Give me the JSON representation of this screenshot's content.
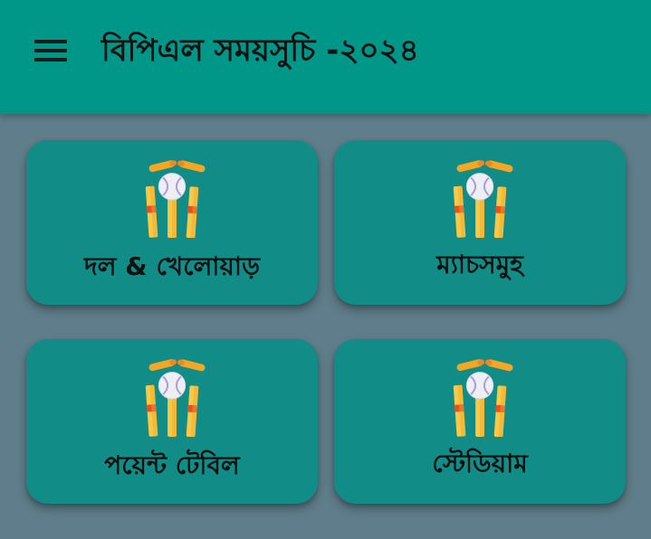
{
  "app": {
    "title": "বিপিএল সময়সুচি -২০২৪",
    "menu_icon": "hamburger-menu-icon"
  },
  "colors": {
    "appbar": "#009688",
    "background": "#5f7d8a",
    "card": "#128c86"
  },
  "menu_cards": [
    {
      "label": "দল & খেলোয়াড়",
      "icon": "cricket-wicket-icon"
    },
    {
      "label": "ম্যাচসমুহ",
      "icon": "cricket-wicket-icon"
    },
    {
      "label": "পয়েন্ট টেবিল",
      "icon": "cricket-wicket-icon"
    },
    {
      "label": "স্টেডিয়াম",
      "icon": "cricket-wicket-icon"
    }
  ]
}
